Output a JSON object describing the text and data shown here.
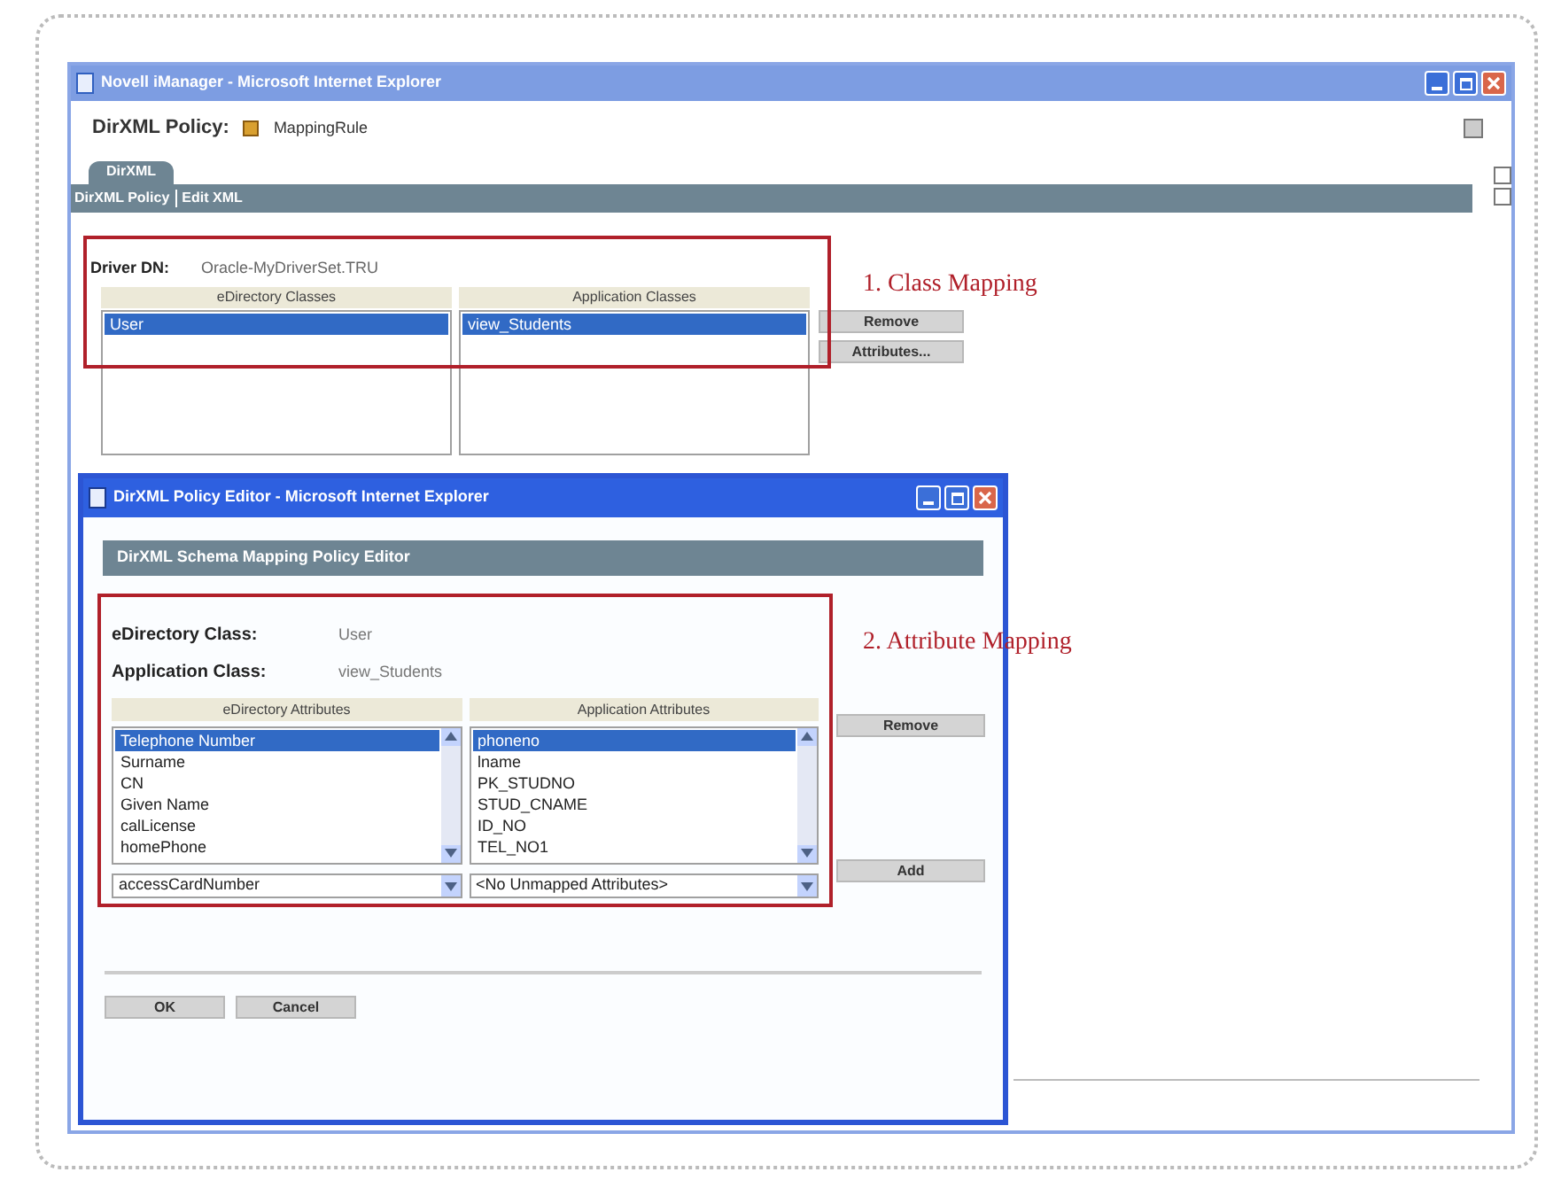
{
  "main_window": {
    "title": "Novell iManager - Microsoft Internet Explorer",
    "policy_label": "DirXML Policy:",
    "policy_name": "MappingRule",
    "tabs": [
      {
        "label": "DirXML",
        "selected": true
      }
    ],
    "tab_links": [
      "DirXML Policy",
      "Edit XML"
    ],
    "driver_dn_label": "Driver DN:",
    "driver_dn": "Oracle-MyDriverSet.TRU",
    "class_columns": [
      "eDirectory Classes",
      "Application Classes"
    ],
    "edirectory_classes": [
      {
        "label": "User",
        "selected": true
      }
    ],
    "application_classes": [
      {
        "label": "view_Students",
        "selected": true
      }
    ],
    "buttons": [
      "Remove",
      "Attributes..."
    ]
  },
  "annotations": [
    "1. Class Mapping",
    "2. Attribute Mapping"
  ],
  "dialog": {
    "title": "DirXML Policy Editor - Microsoft Internet Explorer",
    "header": "DirXML Schema Mapping Policy Editor",
    "edirectory_class_label": "eDirectory Class:",
    "edirectory_class": "User",
    "application_class_label": "Application Class:",
    "application_class": "view_Students",
    "attribute_columns": [
      "eDirectory Attributes",
      "Application Attributes"
    ],
    "edirectory_attributes": [
      {
        "label": "Telephone Number",
        "selected": true
      },
      {
        "label": "Surname",
        "selected": false
      },
      {
        "label": "CN",
        "selected": false
      },
      {
        "label": "Given Name",
        "selected": false
      },
      {
        "label": "calLicense",
        "selected": false
      },
      {
        "label": "homePhone",
        "selected": false
      }
    ],
    "application_attributes": [
      {
        "label": "phoneno",
        "selected": true
      },
      {
        "label": "lname",
        "selected": false
      },
      {
        "label": "PK_STUDNO",
        "selected": false
      },
      {
        "label": "STUD_CNAME",
        "selected": false
      },
      {
        "label": "ID_NO",
        "selected": false
      },
      {
        "label": "TEL_NO1",
        "selected": false
      }
    ],
    "remove_button": "Remove",
    "unmapped_edirectory": "accessCardNumber",
    "unmapped_application": "<No Unmapped Attributes>",
    "add_button": "Add",
    "ok_button": "OK",
    "cancel_button": "Cancel"
  }
}
